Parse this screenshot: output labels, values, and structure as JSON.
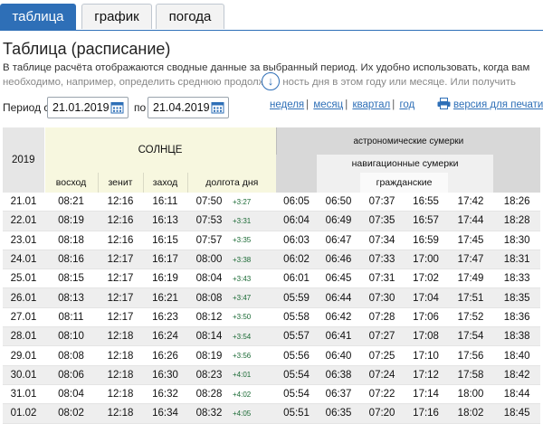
{
  "tabs": [
    {
      "label": "таблица",
      "active": true
    },
    {
      "label": "график",
      "active": false
    },
    {
      "label": "погода",
      "active": false
    }
  ],
  "heading": "Таблица (расписание)",
  "description": {
    "line1": "В таблице расчёта отображаются сводные данные за выбранный период. Их удобно использовать, когда вам",
    "line2": "необходимо, например, определить среднюю продолж",
    "line2b": "ность дня в этом году или месяце. Или получить"
  },
  "period": {
    "label_from": "Период с",
    "from": "21.01.2019",
    "label_to": "по",
    "to": "21.04.2019"
  },
  "range_links": [
    "неделя",
    "месяц",
    "квартал",
    "год"
  ],
  "print_label": "версия для печати",
  "table": {
    "year": "2019",
    "sun_header": "СОЛНЦЕ",
    "sun_columns": [
      "восход",
      "зенит",
      "заход",
      "долгота дня"
    ],
    "astro_header": "астрономические сумерки",
    "nav_header": "навигационные сумерки",
    "civil_header": "гражданские",
    "rows": [
      [
        "21.01",
        "08:21",
        "12:16",
        "16:11",
        "07:50",
        "+3:27",
        "06:05",
        "06:50",
        "07:37",
        "16:55",
        "17:42",
        "18:26"
      ],
      [
        "22.01",
        "08:19",
        "12:16",
        "16:13",
        "07:53",
        "+3:31",
        "06:04",
        "06:49",
        "07:35",
        "16:57",
        "17:44",
        "18:28"
      ],
      [
        "23.01",
        "08:18",
        "12:16",
        "16:15",
        "07:57",
        "+3:35",
        "06:03",
        "06:47",
        "07:34",
        "16:59",
        "17:45",
        "18:30"
      ],
      [
        "24.01",
        "08:16",
        "12:17",
        "16:17",
        "08:00",
        "+3:38",
        "06:02",
        "06:46",
        "07:33",
        "17:00",
        "17:47",
        "18:31"
      ],
      [
        "25.01",
        "08:15",
        "12:17",
        "16:19",
        "08:04",
        "+3:43",
        "06:01",
        "06:45",
        "07:31",
        "17:02",
        "17:49",
        "18:33"
      ],
      [
        "26.01",
        "08:13",
        "12:17",
        "16:21",
        "08:08",
        "+3:47",
        "05:59",
        "06:44",
        "07:30",
        "17:04",
        "17:51",
        "18:35"
      ],
      [
        "27.01",
        "08:11",
        "12:17",
        "16:23",
        "08:12",
        "+3:50",
        "05:58",
        "06:42",
        "07:28",
        "17:06",
        "17:52",
        "18:36"
      ],
      [
        "28.01",
        "08:10",
        "12:18",
        "16:24",
        "08:14",
        "+3:54",
        "05:57",
        "06:41",
        "07:27",
        "17:08",
        "17:54",
        "18:38"
      ],
      [
        "29.01",
        "08:08",
        "12:18",
        "16:26",
        "08:19",
        "+3:56",
        "05:56",
        "06:40",
        "07:25",
        "17:10",
        "17:56",
        "18:40"
      ],
      [
        "30.01",
        "08:06",
        "12:18",
        "16:30",
        "08:23",
        "+4:01",
        "05:54",
        "06:38",
        "07:24",
        "17:12",
        "17:58",
        "18:42"
      ],
      [
        "31.01",
        "08:04",
        "12:18",
        "16:32",
        "08:28",
        "+4:02",
        "05:54",
        "06:37",
        "07:22",
        "17:14",
        "18:00",
        "18:44"
      ],
      [
        "01.02",
        "08:02",
        "12:18",
        "16:34",
        "08:32",
        "+4:05",
        "05:51",
        "06:35",
        "07:20",
        "17:16",
        "18:02",
        "18:45"
      ]
    ]
  },
  "colors": {
    "accent": "#2e6fb7",
    "sun_header_bg": "#f7f7df",
    "delta_green": "#1b6a35"
  }
}
